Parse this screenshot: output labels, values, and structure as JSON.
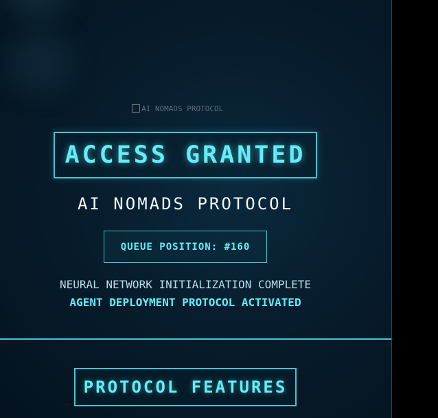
{
  "hero": {
    "image_alt": "AI NOMADS PROTOCOL",
    "icon": "broken-image-icon"
  },
  "access": {
    "title": "ACCESS GRANTED"
  },
  "subtitle": "AI NOMADS PROTOCOL",
  "queue": {
    "label": "QUEUE POSITION: #160"
  },
  "status": {
    "line1": "NEURAL NETWORK INITIALIZATION COMPLETE",
    "line2": "AGENT DEPLOYMENT PROTOCOL ACTIVATED"
  },
  "features": {
    "title": "PROTOCOL FEATURES"
  },
  "colors": {
    "accent": "#62eef8",
    "border": "#46c4d2",
    "background": "#071c2c"
  }
}
